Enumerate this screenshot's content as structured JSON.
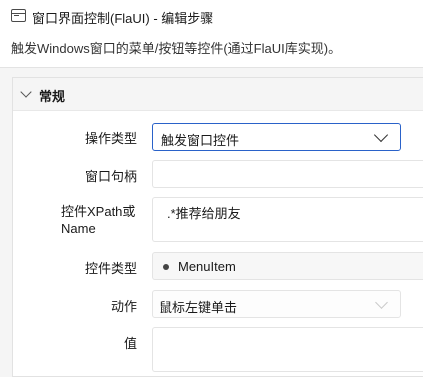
{
  "window": {
    "title": "窗口界面控制(FlaUI)  -  编辑步骤",
    "icon": "window-icon"
  },
  "description": "触发Windows窗口的菜单/按钮等控件(通过FlaUI库实现)。",
  "group": {
    "title": "常规",
    "expanded": true
  },
  "fields": {
    "operation_type": {
      "label": "操作类型",
      "value": "触发窗口控件"
    },
    "window_handle": {
      "label": "窗口句柄",
      "value": ""
    },
    "control_xpath": {
      "label": "控件XPath或Name",
      "value": ".*推荐给朋友"
    },
    "control_type": {
      "label": "控件类型",
      "value": "MenuItem"
    },
    "action": {
      "label": "动作",
      "value": "鼠标左键单击"
    },
    "value": {
      "label": "值",
      "value": ""
    }
  },
  "colors": {
    "accent": "#2a62c9",
    "panel_bg": "#f5f5f5",
    "border": "#e4e4e4"
  }
}
